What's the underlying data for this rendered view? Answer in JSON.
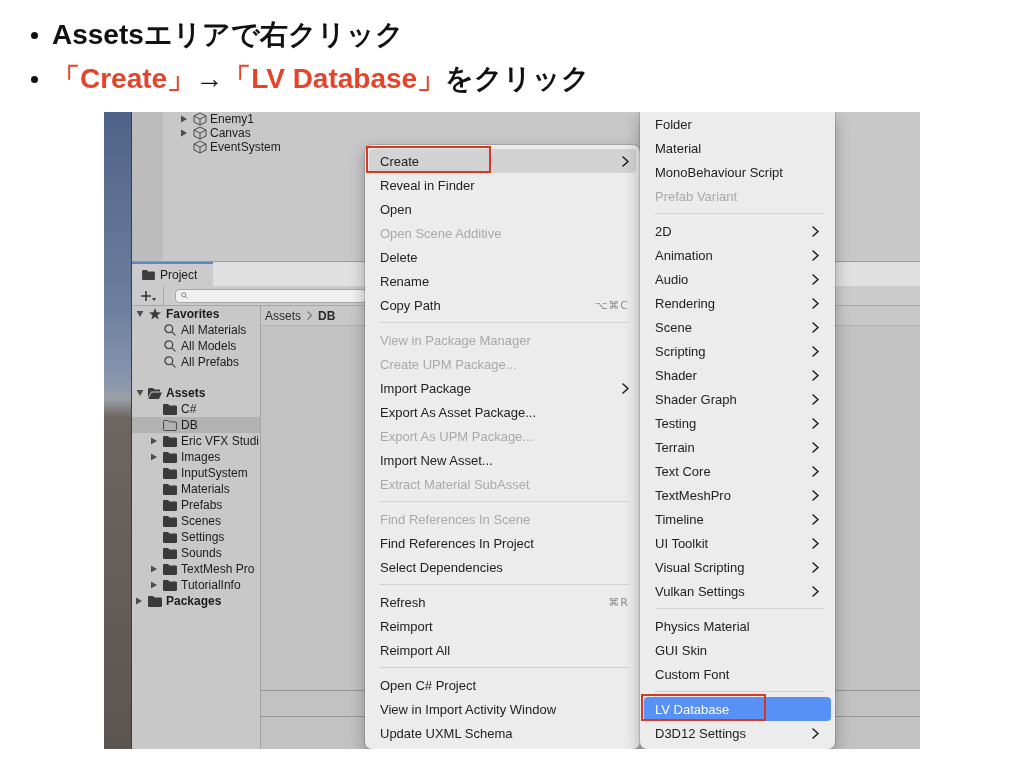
{
  "bullets": [
    {
      "segments": [
        {
          "text": "Assetsエリアで右クリック",
          "emphasis": false
        }
      ]
    },
    {
      "segments": [
        {
          "text": "「Create」",
          "emphasis": true
        },
        {
          "text": "→",
          "emphasis": false
        },
        {
          "text": "「LV Database」",
          "emphasis": true
        },
        {
          "text": "をクリック",
          "emphasis": false
        }
      ]
    }
  ],
  "hierarchy": {
    "items": [
      {
        "label": "Enemy1",
        "expanded": false,
        "selected": false
      },
      {
        "label": "Canvas",
        "expanded": false,
        "selected": false
      },
      {
        "label": "EventSystem",
        "selected": false
      }
    ]
  },
  "project_panel": {
    "tab": {
      "label": "Project",
      "selected": true
    },
    "breadcrumb": [
      "Assets",
      "DB"
    ],
    "tree": [
      {
        "label": "Favorites",
        "kind": "favorites",
        "expanded": true,
        "selected": false,
        "children": [
          {
            "label": "All Materials",
            "kind": "search",
            "selected": false
          },
          {
            "label": "All Models",
            "kind": "search",
            "selected": false
          },
          {
            "label": "All Prefabs",
            "kind": "search",
            "selected": false
          }
        ]
      },
      {
        "label": "Assets",
        "kind": "folder",
        "expanded": true,
        "selected": false,
        "children": [
          {
            "label": "C#",
            "kind": "folder",
            "selected": false
          },
          {
            "label": "DB",
            "kind": "empty-folder",
            "selected": true
          },
          {
            "label": "Eric VFX Studi",
            "kind": "folder",
            "expanded": false,
            "selected": false
          },
          {
            "label": "Images",
            "kind": "folder",
            "expanded": false,
            "selected": false
          },
          {
            "label": "InputSystem",
            "kind": "folder",
            "selected": false
          },
          {
            "label": "Materials",
            "kind": "folder",
            "selected": false
          },
          {
            "label": "Prefabs",
            "kind": "folder",
            "selected": false
          },
          {
            "label": "Scenes",
            "kind": "folder",
            "selected": false
          },
          {
            "label": "Settings",
            "kind": "folder",
            "selected": false
          },
          {
            "label": "Sounds",
            "kind": "folder",
            "selected": false
          },
          {
            "label": "TextMesh Pro",
            "kind": "folder",
            "expanded": false,
            "selected": false
          },
          {
            "label": "TutorialInfo",
            "kind": "folder",
            "expanded": false,
            "selected": false
          }
        ]
      },
      {
        "label": "Packages",
        "kind": "folder",
        "expanded": false,
        "selected": false
      }
    ]
  },
  "context_menu": {
    "sections": [
      [
        {
          "label": "Create",
          "submenu": true,
          "disabled": false,
          "selected": true,
          "boxed": true
        },
        {
          "label": "Reveal in Finder",
          "submenu": false,
          "disabled": false,
          "selected": false,
          "boxed": false
        },
        {
          "label": "Open",
          "submenu": false,
          "disabled": false,
          "selected": false,
          "boxed": false
        },
        {
          "label": "Open Scene Additive",
          "submenu": false,
          "disabled": true,
          "selected": false,
          "boxed": false
        },
        {
          "label": "Delete",
          "submenu": false,
          "disabled": false,
          "selected": false,
          "boxed": false
        },
        {
          "label": "Rename",
          "submenu": false,
          "disabled": false,
          "selected": false,
          "boxed": false
        },
        {
          "label": "Copy Path",
          "shortcut": "⌥⌘C",
          "submenu": false,
          "disabled": false,
          "selected": false,
          "boxed": false
        }
      ],
      [
        {
          "label": "View in Package Manager",
          "submenu": false,
          "disabled": true,
          "selected": false,
          "boxed": false
        },
        {
          "label": "Create UPM Package...",
          "submenu": false,
          "disabled": true,
          "selected": false,
          "boxed": false
        },
        {
          "label": "Import Package",
          "submenu": true,
          "disabled": false,
          "selected": false,
          "boxed": false
        },
        {
          "label": "Export As Asset Package...",
          "submenu": false,
          "disabled": false,
          "selected": false,
          "boxed": false
        },
        {
          "label": "Export As UPM Package...",
          "submenu": false,
          "disabled": true,
          "selected": false,
          "boxed": false
        },
        {
          "label": "Import New Asset...",
          "submenu": false,
          "disabled": false,
          "selected": false,
          "boxed": false
        },
        {
          "label": "Extract Material SubAsset",
          "submenu": false,
          "disabled": true,
          "selected": false,
          "boxed": false
        }
      ],
      [
        {
          "label": "Find References In Scene",
          "submenu": false,
          "disabled": true,
          "selected": false,
          "boxed": false
        },
        {
          "label": "Find References In Project",
          "submenu": false,
          "disabled": false,
          "selected": false,
          "boxed": false
        },
        {
          "label": "Select Dependencies",
          "submenu": false,
          "disabled": false,
          "selected": false,
          "boxed": false
        }
      ],
      [
        {
          "label": "Refresh",
          "shortcut": "⌘R",
          "submenu": false,
          "disabled": false,
          "selected": false,
          "boxed": false
        },
        {
          "label": "Reimport",
          "submenu": false,
          "disabled": false,
          "selected": false,
          "boxed": false
        },
        {
          "label": "Reimport All",
          "submenu": false,
          "disabled": false,
          "selected": false,
          "boxed": false
        }
      ],
      [
        {
          "label": "Open C# Project",
          "submenu": false,
          "disabled": false,
          "selected": false,
          "boxed": false
        },
        {
          "label": "View in Import Activity Window",
          "submenu": false,
          "disabled": false,
          "selected": false,
          "boxed": false
        },
        {
          "label": "Update UXML Schema",
          "submenu": false,
          "disabled": false,
          "selected": false,
          "boxed": false
        }
      ]
    ]
  },
  "create_submenu": {
    "sections": [
      [
        {
          "label": "Folder",
          "submenu": false,
          "disabled": false,
          "selected": false,
          "boxed": false
        },
        {
          "label": "Material",
          "submenu": false,
          "disabled": false,
          "selected": false,
          "boxed": false
        },
        {
          "label": "MonoBehaviour Script",
          "submenu": false,
          "disabled": false,
          "selected": false,
          "boxed": false
        },
        {
          "label": "Prefab Variant",
          "submenu": false,
          "disabled": true,
          "selected": false,
          "boxed": false
        }
      ],
      [
        {
          "label": "2D",
          "submenu": true,
          "disabled": false,
          "selected": false,
          "boxed": false
        },
        {
          "label": "Animation",
          "submenu": true,
          "disabled": false,
          "selected": false,
          "boxed": false
        },
        {
          "label": "Audio",
          "submenu": true,
          "disabled": false,
          "selected": false,
          "boxed": false
        },
        {
          "label": "Rendering",
          "submenu": true,
          "disabled": false,
          "selected": false,
          "boxed": false
        },
        {
          "label": "Scene",
          "submenu": true,
          "disabled": false,
          "selected": false,
          "boxed": false
        },
        {
          "label": "Scripting",
          "submenu": true,
          "disabled": false,
          "selected": false,
          "boxed": false
        },
        {
          "label": "Shader",
          "submenu": true,
          "disabled": false,
          "selected": false,
          "boxed": false
        },
        {
          "label": "Shader Graph",
          "submenu": true,
          "disabled": false,
          "selected": false,
          "boxed": false
        },
        {
          "label": "Testing",
          "submenu": true,
          "disabled": false,
          "selected": false,
          "boxed": false
        },
        {
          "label": "Terrain",
          "submenu": true,
          "disabled": false,
          "selected": false,
          "boxed": false
        },
        {
          "label": "Text Core",
          "submenu": true,
          "disabled": false,
          "selected": false,
          "boxed": false
        },
        {
          "label": "TextMeshPro",
          "submenu": true,
          "disabled": false,
          "selected": false,
          "boxed": false
        },
        {
          "label": "Timeline",
          "submenu": true,
          "disabled": false,
          "selected": false,
          "boxed": false
        },
        {
          "label": "UI Toolkit",
          "submenu": true,
          "disabled": false,
          "selected": false,
          "boxed": false
        },
        {
          "label": "Visual Scripting",
          "submenu": true,
          "disabled": false,
          "selected": false,
          "boxed": false
        },
        {
          "label": "Vulkan Settings",
          "submenu": true,
          "disabled": false,
          "selected": false,
          "boxed": false
        }
      ],
      [
        {
          "label": "Physics Material",
          "submenu": false,
          "disabled": false,
          "selected": false,
          "boxed": false
        },
        {
          "label": "GUI Skin",
          "submenu": false,
          "disabled": false,
          "selected": false,
          "boxed": false
        },
        {
          "label": "Custom Font",
          "submenu": false,
          "disabled": false,
          "selected": false,
          "boxed": false
        }
      ],
      [
        {
          "label": "LV Database",
          "submenu": false,
          "disabled": false,
          "selected": true,
          "boxed": true
        },
        {
          "label": "D3D12 Settings",
          "submenu": true,
          "disabled": false,
          "selected": false,
          "boxed": false
        }
      ]
    ]
  }
}
